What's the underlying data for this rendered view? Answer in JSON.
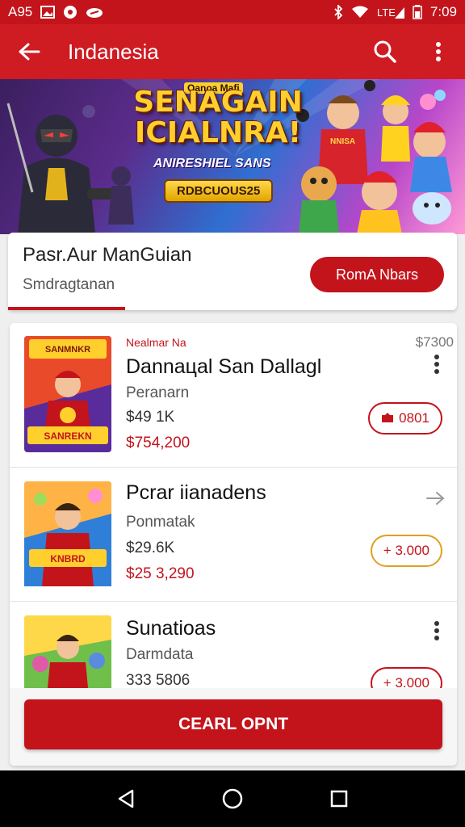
{
  "status_bar": {
    "left_text": "A95",
    "time": "7:09",
    "icons": [
      "image-icon",
      "circle-badge-icon",
      "cloud-icon",
      "bluetooth-icon",
      "wifi-icon",
      "signal-icon",
      "battery-icon"
    ]
  },
  "app_bar": {
    "title": "Indanesia",
    "icons": [
      "arrow-back-icon",
      "search-icon",
      "more-vert-icon"
    ]
  },
  "banner": {
    "top_label": "Oanoa Mafi",
    "title_line1": "SENAGAIN",
    "title_line2": "ICIALNRA!",
    "subtitle": "ANIRESHIEL SANS",
    "badge": "RDBCUOUS25",
    "shirt_text": "NNISA"
  },
  "info_card": {
    "title": "Pasr.Aur ManGuian",
    "subtitle": "Smdragtanan",
    "button_label": "RomA Nbars"
  },
  "items": [
    {
      "kicker": "Nealmar Na",
      "corner": "$7300",
      "name": "Dannaцal San Dallagl",
      "sub": "Peranarn",
      "price": "$49 1K",
      "total": "$754,200",
      "chip_label": "0801",
      "chip_icon": "ticket-icon",
      "action_icon": "more-vert-icon"
    },
    {
      "kicker": "",
      "corner": "",
      "name": "Pcrar iianadens",
      "sub": "Ponmatak",
      "price": "$29.6K",
      "total": "$25 3,290",
      "chip_label": "+ 3.000",
      "chip_icon": "",
      "action_icon": "arrow-right-icon"
    },
    {
      "kicker": "",
      "corner": "",
      "name": "Sunatioas",
      "sub": "Darmdata",
      "price": "333 5806",
      "total": "",
      "chip_label": "+ 3.000",
      "chip_icon": "",
      "action_icon": "more-vert-icon"
    }
  ],
  "cta": {
    "label": "CEARL OPNT"
  },
  "nav_bar": {
    "icons": [
      "back-triangle-icon",
      "home-circle-icon",
      "recents-square-icon"
    ]
  },
  "colors": {
    "accent": "#c3141c",
    "app_bar": "#cf1b22",
    "nav_bar": "#000000"
  }
}
